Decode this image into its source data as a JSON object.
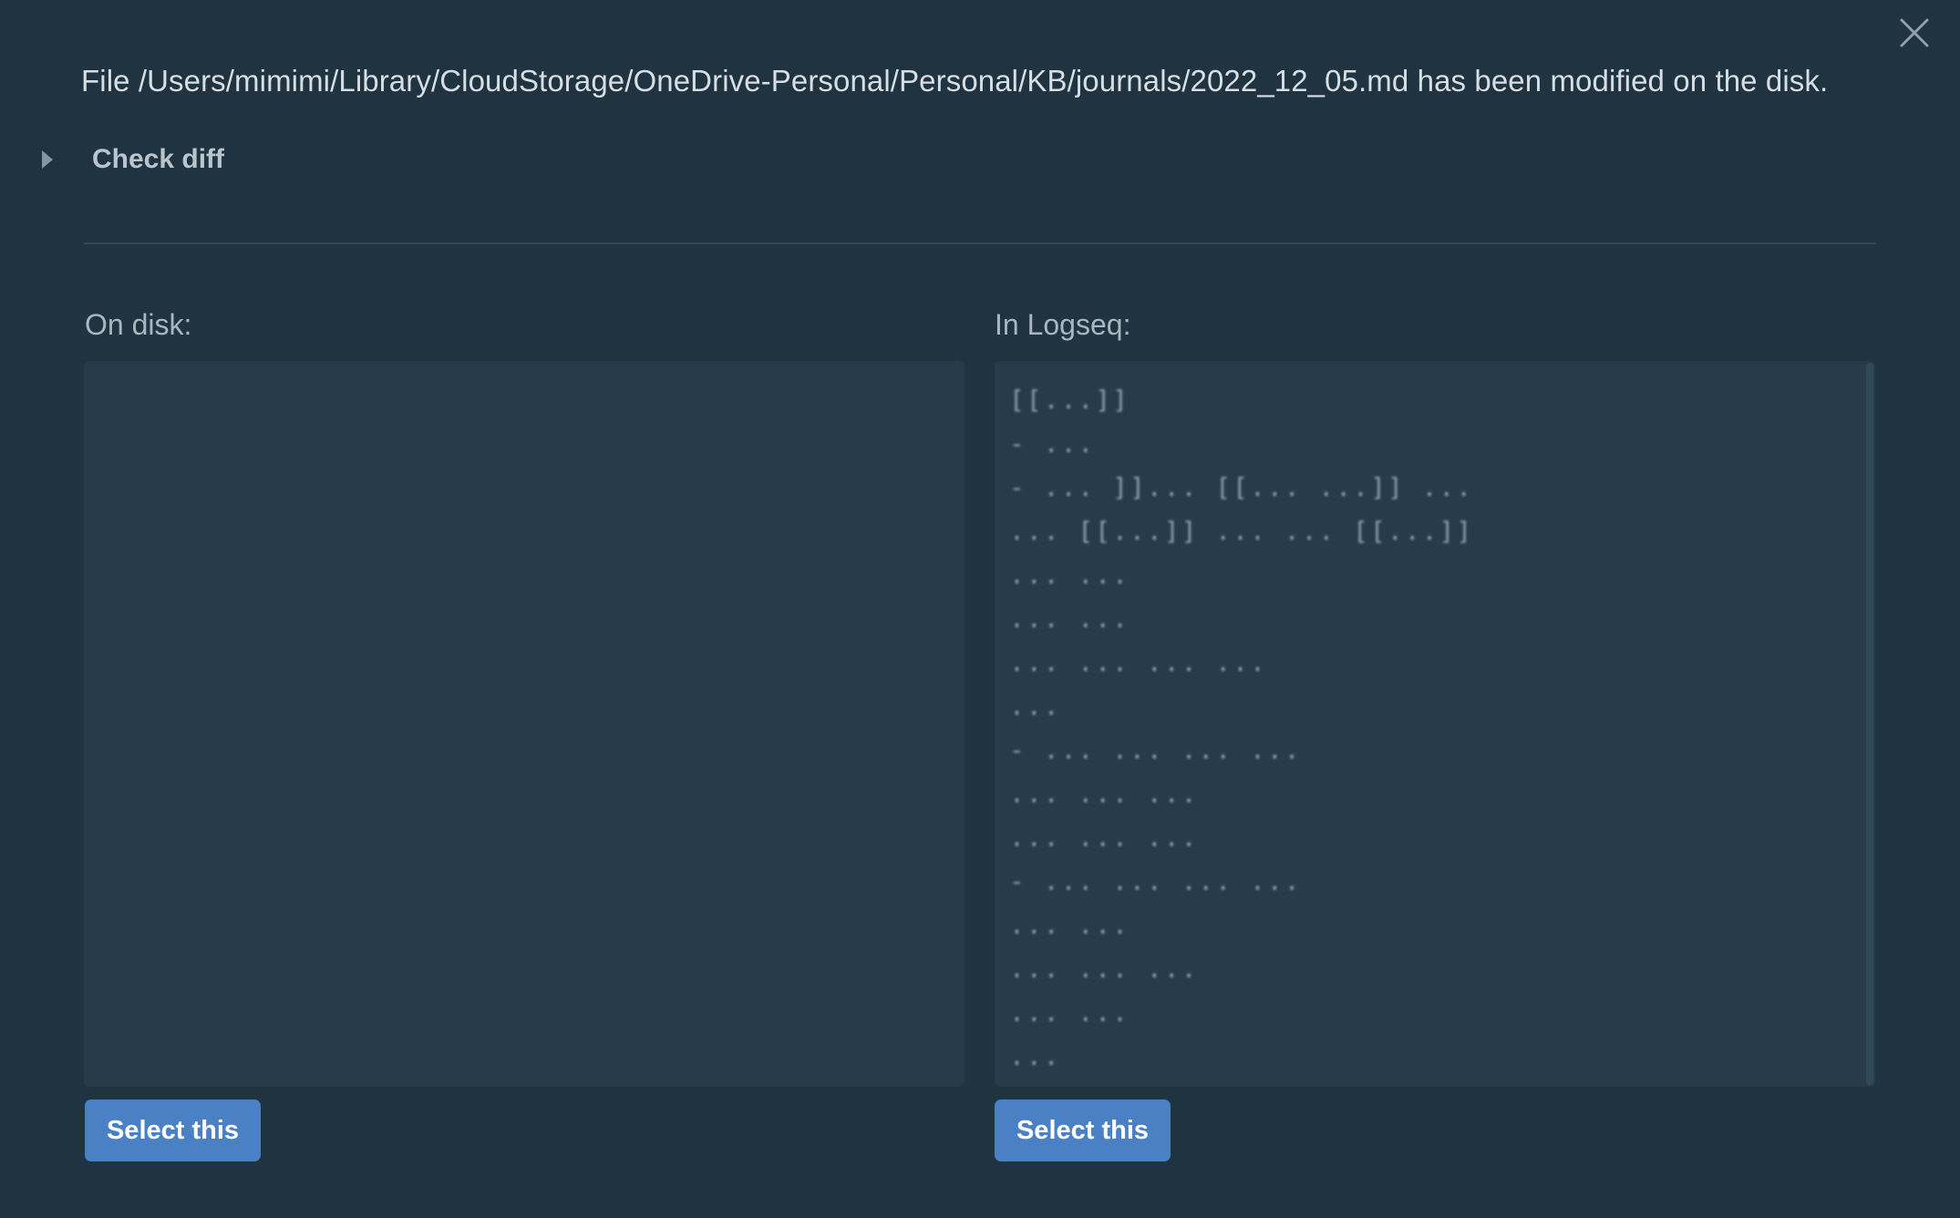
{
  "dialog": {
    "message": "File /Users/mimimi/Library/CloudStorage/OneDrive-Personal/Personal/KB/journals/2022_12_05.md has been modified on the disk.",
    "check_diff_label": "Check diff",
    "close_icon": "close-icon",
    "expand_icon": "triangle-right-icon"
  },
  "left_panel": {
    "title": "On disk:",
    "select_label": "Select this"
  },
  "right_panel": {
    "title": "In Logseq:",
    "select_label": "Select this",
    "lines": [
      " [[...]]",
      "  - ...",
      "  - ... ]]... [[... ...]] ...",
      "... [[...]] ... ... [[...]]",
      "... ...",
      "   ... ...",
      "... ... ... ...",
      "...",
      "  - ... ... ... ...",
      "... ... ...",
      "   ... ... ...",
      "  - ... ... ... ...",
      "... ...",
      "   ... ... ...",
      "   ... ...",
      "   ..."
    ]
  },
  "colors": {
    "background": "#1f3341",
    "panel": "#263c4b",
    "button": "#4a80c4"
  }
}
